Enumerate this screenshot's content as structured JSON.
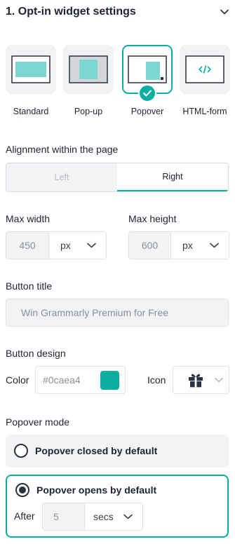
{
  "header": {
    "title": "1. Opt-in widget settings"
  },
  "widget_types": [
    {
      "label": "Standard",
      "selected": false
    },
    {
      "label": "Pop-up",
      "selected": false
    },
    {
      "label": "Popover",
      "selected": true
    },
    {
      "label": "HTML-form",
      "selected": false
    }
  ],
  "alignment": {
    "label": "Alignment within the page",
    "options": [
      "Left",
      "Right"
    ],
    "selected": "Right"
  },
  "max_width": {
    "label": "Max width",
    "value": "450",
    "unit": "px"
  },
  "max_height": {
    "label": "Max height",
    "value": "600",
    "unit": "px"
  },
  "button_title": {
    "label": "Button title",
    "value": "Win Grammarly Premium for Free"
  },
  "button_design": {
    "label": "Button design",
    "color_label": "Color",
    "color_value": "#0caea4",
    "icon_label": "Icon",
    "icon_name": "gift-icon"
  },
  "popover_mode": {
    "label": "Popover mode",
    "options": [
      {
        "label": "Popover closed by default",
        "selected": false
      },
      {
        "label": "Popover opens by default",
        "selected": true
      }
    ],
    "after_label": "After",
    "after_value": "5",
    "after_unit": "secs"
  },
  "colors": {
    "accent": "#0caea4",
    "text": "#1f2433",
    "muted": "#8b909a"
  }
}
